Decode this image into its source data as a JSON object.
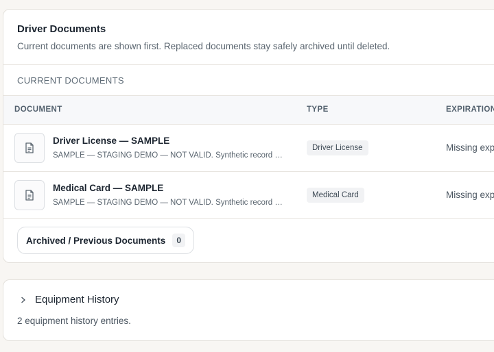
{
  "documents_card": {
    "title": "Driver Documents",
    "subtitle": "Current documents are shown first. Replaced documents stay safely archived until deleted.",
    "section_label": "CURRENT DOCUMENTS",
    "columns": {
      "document": "DOCUMENT",
      "type": "TYPE",
      "expiration": "EXPIRATION"
    },
    "rows": [
      {
        "icon": "document-icon",
        "title": "Driver License — SAMPLE",
        "description": "SAMPLE — STAGING DEMO — NOT VALID. Synthetic record f...",
        "type": "Driver License",
        "expiration": "Missing exp"
      },
      {
        "icon": "document-icon",
        "title": "Medical Card — SAMPLE",
        "description": "SAMPLE — STAGING DEMO — NOT VALID. Synthetic record f...",
        "type": "Medical Card",
        "expiration": "Missing exp"
      }
    ],
    "archived_button": {
      "label": "Archived / Previous Documents",
      "count": "0"
    }
  },
  "equipment_history": {
    "icon": "chevron-right-icon",
    "title": "Equipment History",
    "summary": "2 equipment history entries."
  }
}
